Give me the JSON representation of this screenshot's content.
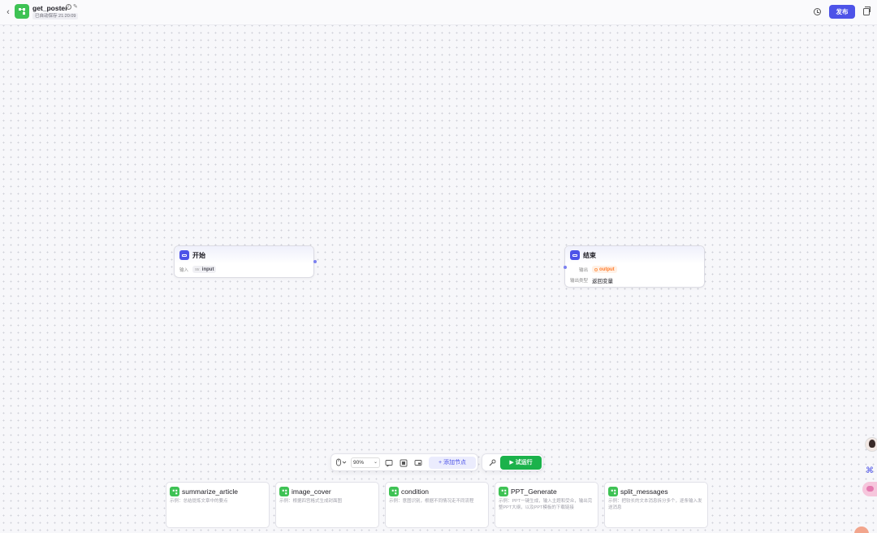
{
  "header": {
    "back_icon": "chevron-left-icon",
    "app_icon": "workflow-icon",
    "app_name": "get_poster",
    "save_status": "已自动保存 21:20:09",
    "publish_label": "发布",
    "brand_color": "#4d53e8"
  },
  "nodes": {
    "start": {
      "title": "开始",
      "input_label": "输入",
      "input_type": "Str.",
      "input_name": "input"
    },
    "end": {
      "title": "结束",
      "output_label": "输出",
      "output_name": "output",
      "output_type_label": "输出类型",
      "output_type_value": "返回变量"
    }
  },
  "toolbar": {
    "zoom": "90%",
    "add_node_label": "+ 添加节点",
    "test_run_label": "▶ 试运行",
    "test_run_color": "#1bb24b"
  },
  "templates": [
    {
      "title": "summarize_article",
      "desc": "示例：总结提炼文章中的要点"
    },
    {
      "title": "image_cover",
      "desc": "示例：根据四宫格式生成封面图"
    },
    {
      "title": "condition",
      "desc": "示例：意图识别，根据不同情况走不同流程"
    },
    {
      "title": "PPT_Generate",
      "desc": "示例：PPT一键生成，输入主题和受众，输出完整PPT大纲，以及PPT模板的下载链接"
    },
    {
      "title": "split_messages",
      "desc": "示例：把较长的文本消息拆分多个，逐条输入发送消息"
    }
  ]
}
